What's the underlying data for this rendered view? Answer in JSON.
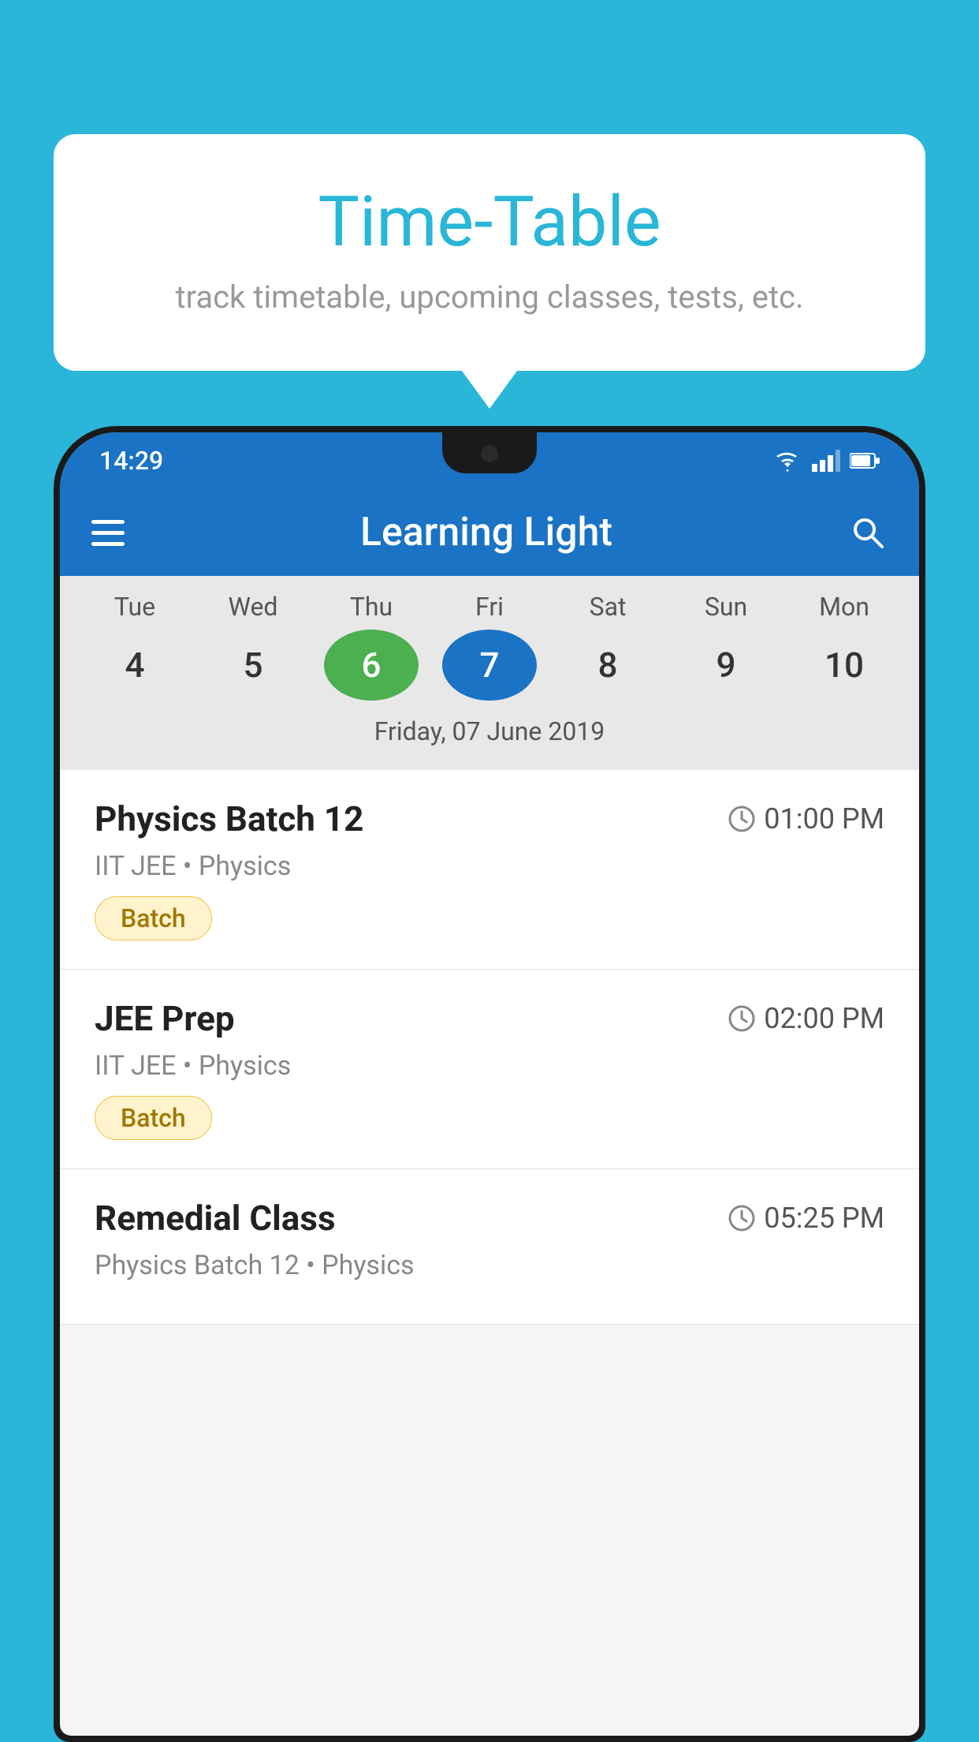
{
  "background_color": "#29b6d8",
  "bubble": {
    "title": "Time-Table",
    "subtitle": "track timetable, upcoming classes, tests, etc."
  },
  "phone": {
    "status_bar": {
      "time": "14:29",
      "icons": [
        "wifi",
        "signal",
        "battery"
      ]
    },
    "app_bar": {
      "title": "Learning Light"
    },
    "calendar": {
      "days": [
        {
          "name": "Tue",
          "num": "4",
          "state": "normal"
        },
        {
          "name": "Wed",
          "num": "5",
          "state": "normal"
        },
        {
          "name": "Thu",
          "num": "6",
          "state": "today"
        },
        {
          "name": "Fri",
          "num": "7",
          "state": "selected"
        },
        {
          "name": "Sat",
          "num": "8",
          "state": "normal"
        },
        {
          "name": "Sun",
          "num": "9",
          "state": "normal"
        },
        {
          "name": "Mon",
          "num": "10",
          "state": "normal"
        }
      ],
      "selected_date_label": "Friday, 07 June 2019"
    },
    "schedule": [
      {
        "title": "Physics Batch 12",
        "time": "01:00 PM",
        "subtitle": "IIT JEE • Physics",
        "badge": "Batch"
      },
      {
        "title": "JEE Prep",
        "time": "02:00 PM",
        "subtitle": "IIT JEE • Physics",
        "badge": "Batch"
      },
      {
        "title": "Remedial Class",
        "time": "05:25 PM",
        "subtitle": "Physics Batch 12 • Physics",
        "badge": null
      }
    ]
  }
}
